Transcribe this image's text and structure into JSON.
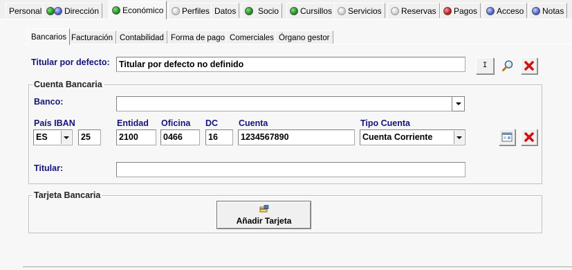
{
  "top_tabs": [
    {
      "label": "Personal",
      "icons": []
    },
    {
      "label": "Dirección",
      "icons": [
        "green",
        "blue"
      ]
    },
    {
      "label": "Económico",
      "icons": [
        "green"
      ]
    },
    {
      "label": "Perfiles",
      "icons": [
        "grey"
      ]
    },
    {
      "label": "Datos",
      "icons": []
    },
    {
      "label": "Socio",
      "icons": [
        "green"
      ]
    },
    {
      "label": "Cursillos",
      "icons": [
        "green"
      ]
    },
    {
      "label": "Servicios",
      "icons": [
        "grey"
      ]
    },
    {
      "label": "Reservas",
      "icons": [
        "grey"
      ]
    },
    {
      "label": "Pagos",
      "icons": [
        "red"
      ]
    },
    {
      "label": "Acceso",
      "icons": [
        "blue"
      ]
    },
    {
      "label": "Notas",
      "icons": [
        "blue"
      ]
    }
  ],
  "sub_tabs": [
    "Bancarios",
    "Facturación",
    "Contabilidad",
    "Forma de pago",
    "Comerciales",
    "Órgano gestor"
  ],
  "titular_defecto": {
    "label": "Titular por defecto:",
    "value": "Titular por defecto no definido",
    "small_button": "I"
  },
  "cuenta_bancaria": {
    "title": "Cuenta Bancaria",
    "banco_label": "Banco:",
    "banco_value": "",
    "pais_iban_label": "País IBAN",
    "pais_value": "ES",
    "iban_check": "25",
    "entidad_label": "Entidad",
    "entidad_value": "2100",
    "oficina_label": "Oficina",
    "oficina_value": "0466",
    "dc_label": "DC",
    "dc_value": "16",
    "cuenta_label": "Cuenta",
    "cuenta_value": "1234567890",
    "tipo_cuenta_label": "Tipo Cuenta",
    "tipo_cuenta_value": "Cuenta Corriente",
    "titular_label": "Titular:",
    "titular_value": ""
  },
  "tarjeta_bancaria": {
    "title": "Tarjeta Bancaria",
    "add_button": "Añadir Tarjeta"
  }
}
